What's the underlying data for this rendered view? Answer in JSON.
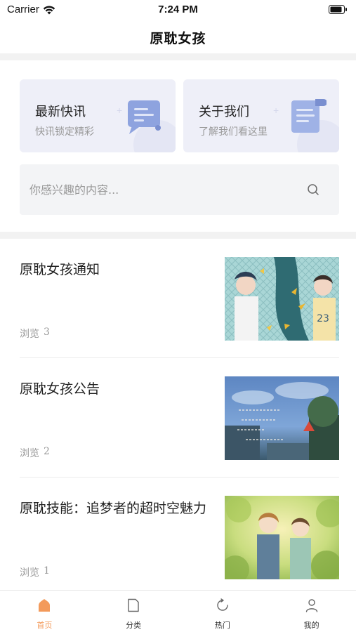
{
  "status_bar": {
    "carrier": "Carrier",
    "time": "7:24 PM"
  },
  "nav": {
    "title": "原耽女孩"
  },
  "cards": [
    {
      "title": "最新快讯",
      "subtitle": "快讯锁定精彩",
      "icon": "chat-bubble-icon"
    },
    {
      "title": "关于我们",
      "subtitle": "了解我们看这里",
      "icon": "document-icon"
    }
  ],
  "search": {
    "placeholder": "你感兴趣的内容..."
  },
  "news": [
    {
      "title": "原耽女孩通知",
      "views_label": "浏览",
      "views": "3",
      "image": "two boys under tree with fence illustration"
    },
    {
      "title": "原耽女孩公告",
      "views_label": "浏览",
      "views": "2",
      "image": "blue sky street scene with handwritten text"
    },
    {
      "title": "原耽技能：追梦者的超时空魅力",
      "views_label": "浏览",
      "views": "1",
      "image": "two boys in green sunny foliage illustration"
    }
  ],
  "tabs": [
    {
      "label": "首页",
      "icon": "home-icon",
      "active": true
    },
    {
      "label": "分类",
      "icon": "category-icon",
      "active": false
    },
    {
      "label": "热门",
      "icon": "hot-icon",
      "active": false
    },
    {
      "label": "我的",
      "icon": "profile-icon",
      "active": false
    }
  ],
  "colors": {
    "accent": "#f39a5b",
    "card_bg": "#eeeff8",
    "icon_blue": "#8ea3df"
  }
}
